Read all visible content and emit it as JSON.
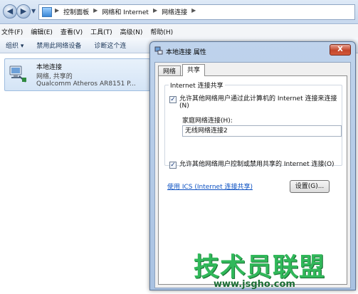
{
  "address_bar": {
    "crumbs": [
      "控制面板",
      "网络和 Internet",
      "网络连接"
    ],
    "separator": "▶"
  },
  "menu": {
    "items": [
      "文件(F)",
      "编辑(E)",
      "查看(V)",
      "工具(T)",
      "高级(N)",
      "帮助(H)"
    ]
  },
  "command_bar": {
    "organize": "组织 ▾",
    "disable": "禁用此网络设备",
    "diagnose": "诊断这个连"
  },
  "connection": {
    "name": "本地连接",
    "status": "网络, 共享的",
    "device": "Qualcomm Atheros AR8151 P..."
  },
  "dialog": {
    "title": "本地连接 属性",
    "close_glyph": "X",
    "tabs": [
      "网络",
      "共享"
    ],
    "group_label": "Internet 连接共享",
    "allow_connect": "允许其他网络用户通过此计算机的 Internet 连接来连接(N)",
    "home_label": "家庭网络连接(H):",
    "home_value": "无线网络连接2",
    "allow_control": "允许其他网络用户控制或禁用共享的 Internet 连接(O)",
    "ics_link": "使用 ICS (Internet 连接共享)",
    "settings_button": "设置(G)...",
    "check_glyph": "✓"
  },
  "watermark": {
    "title": "技术员联盟",
    "url": "www.jsgho.com"
  }
}
